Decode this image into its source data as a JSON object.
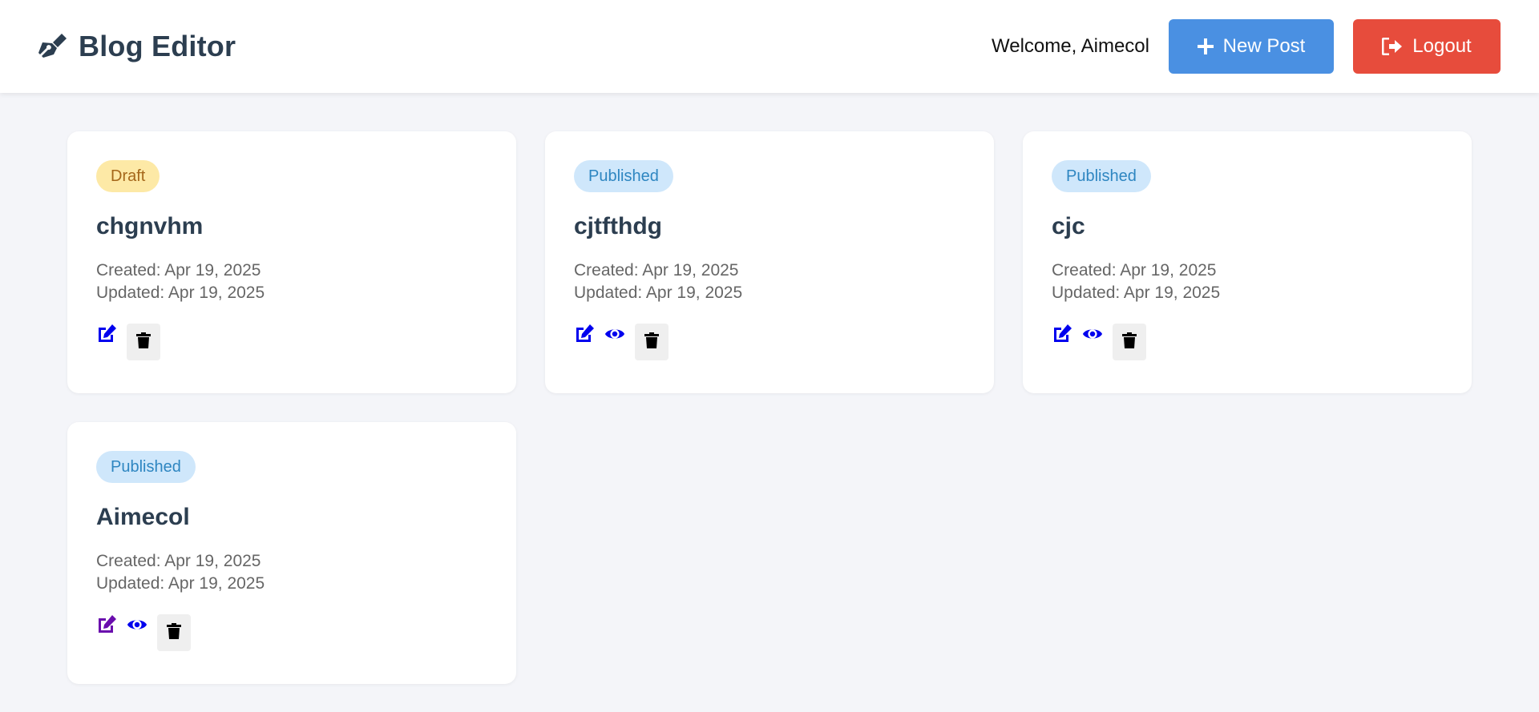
{
  "header": {
    "title": "Blog Editor",
    "brand_icon": "pen-nib-icon",
    "welcome": "Welcome, Aimecol",
    "new_post_label": "New Post",
    "logout_label": "Logout"
  },
  "colors": {
    "primary": "#4a90e2",
    "danger": "#e74c3c",
    "draft_badge_bg": "#fde9a6",
    "published_badge_bg": "#cfe7fb",
    "action_icon": "#0000ee",
    "visited_icon": "#6a0dad"
  },
  "posts": [
    {
      "status": "Draft",
      "title": "chgnvhm",
      "created": "Created: Apr 19, 2025",
      "updated": "Updated: Apr 19, 2025"
    },
    {
      "status": "Published",
      "title": "cjtfthdg",
      "created": "Created: Apr 19, 2025",
      "updated": "Updated: Apr 19, 2025"
    },
    {
      "status": "Published",
      "title": "cjc",
      "created": "Created: Apr 19, 2025",
      "updated": "Updated: Apr 19, 2025"
    },
    {
      "status": "Published",
      "title": "Aimecol",
      "created": "Created: Apr 19, 2025",
      "updated": "Updated: Apr 19, 2025"
    }
  ]
}
